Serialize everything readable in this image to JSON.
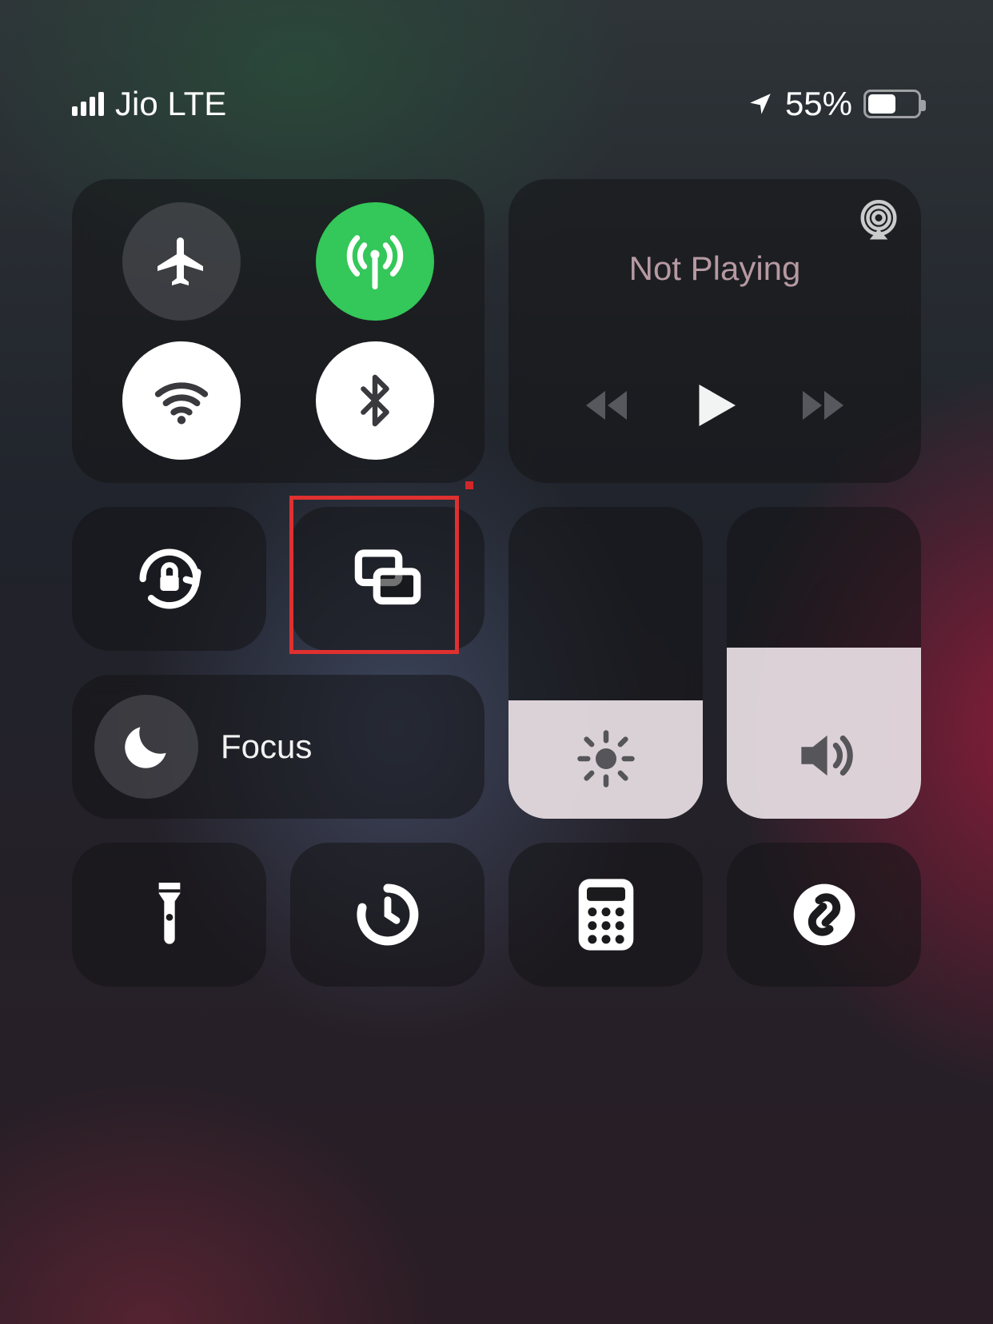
{
  "status": {
    "carrier": "Jio LTE",
    "battery_percent_text": "55%",
    "battery_percent_value": 55,
    "location_services_on": true
  },
  "connectivity": {
    "airplane_mode": {
      "on": false,
      "icon": "airplane"
    },
    "cellular": {
      "on": true,
      "icon": "antenna"
    },
    "wifi": {
      "on": true,
      "icon": "wifi"
    },
    "bluetooth": {
      "on": true,
      "icon": "bluetooth"
    }
  },
  "media": {
    "title": "Not Playing",
    "has_airplay_button": true
  },
  "rotation_lock": {
    "locked": true
  },
  "screen_mirroring": {
    "label": "Screen Mirroring"
  },
  "focus": {
    "label": "Focus",
    "active": false
  },
  "brightness": {
    "value_percent": 38
  },
  "volume": {
    "value_percent": 55
  },
  "annotation": {
    "highlighted_control": "screen-mirroring-button"
  }
}
